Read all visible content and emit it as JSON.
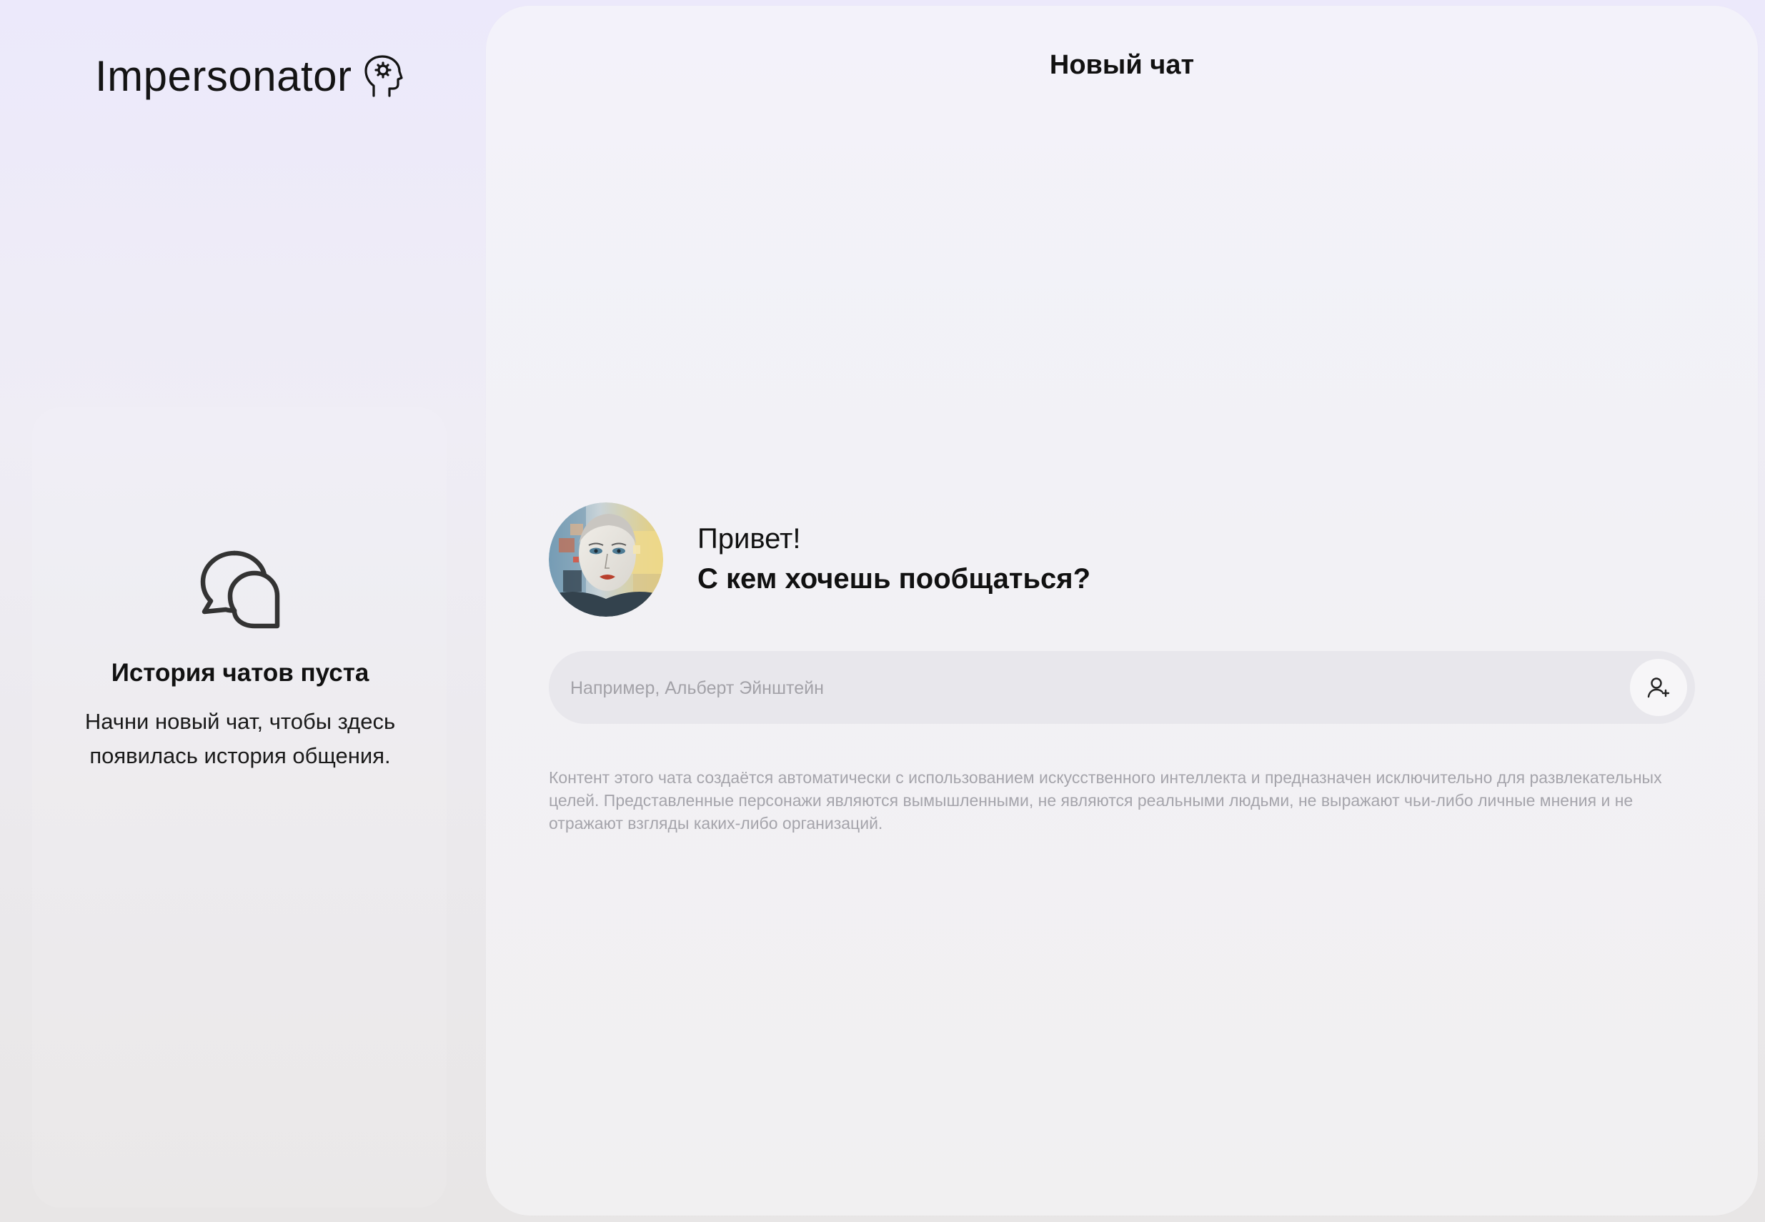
{
  "sidebar": {
    "logo_text": "Impersonator",
    "logo_icon": "head-gear-icon",
    "empty_state": {
      "icon": "chat-bubbles-icon",
      "title": "История чатов пуста",
      "description": "Начни новый чат, чтобы здесь появилась история общения."
    }
  },
  "main": {
    "title": "Новый чат",
    "greeting": {
      "hello": "Привет!",
      "question": "С кем хочешь пообщаться?"
    },
    "search": {
      "placeholder": "Например, Альберт Эйнштейн",
      "value": "",
      "button_icon": "person-add-icon"
    },
    "disclaimer": "Контент этого чата создаётся автоматически с использованием искусственного интеллекта и предназначен исключительно для развлекательных целей. Представленные персонажи являются вымышленными, не являются реальными людьми, не выражают чьи-либо личные мнения и не отражают взгляды каких-либо организаций."
  },
  "colors": {
    "background_top": "#ece9fb",
    "background_bottom": "#e8e6e6",
    "panel": "#f2f1f5",
    "input_background": "#e8e7ec",
    "placeholder": "#a3a2a8",
    "disclaimer": "#a5a4ab",
    "text": "#111111"
  }
}
